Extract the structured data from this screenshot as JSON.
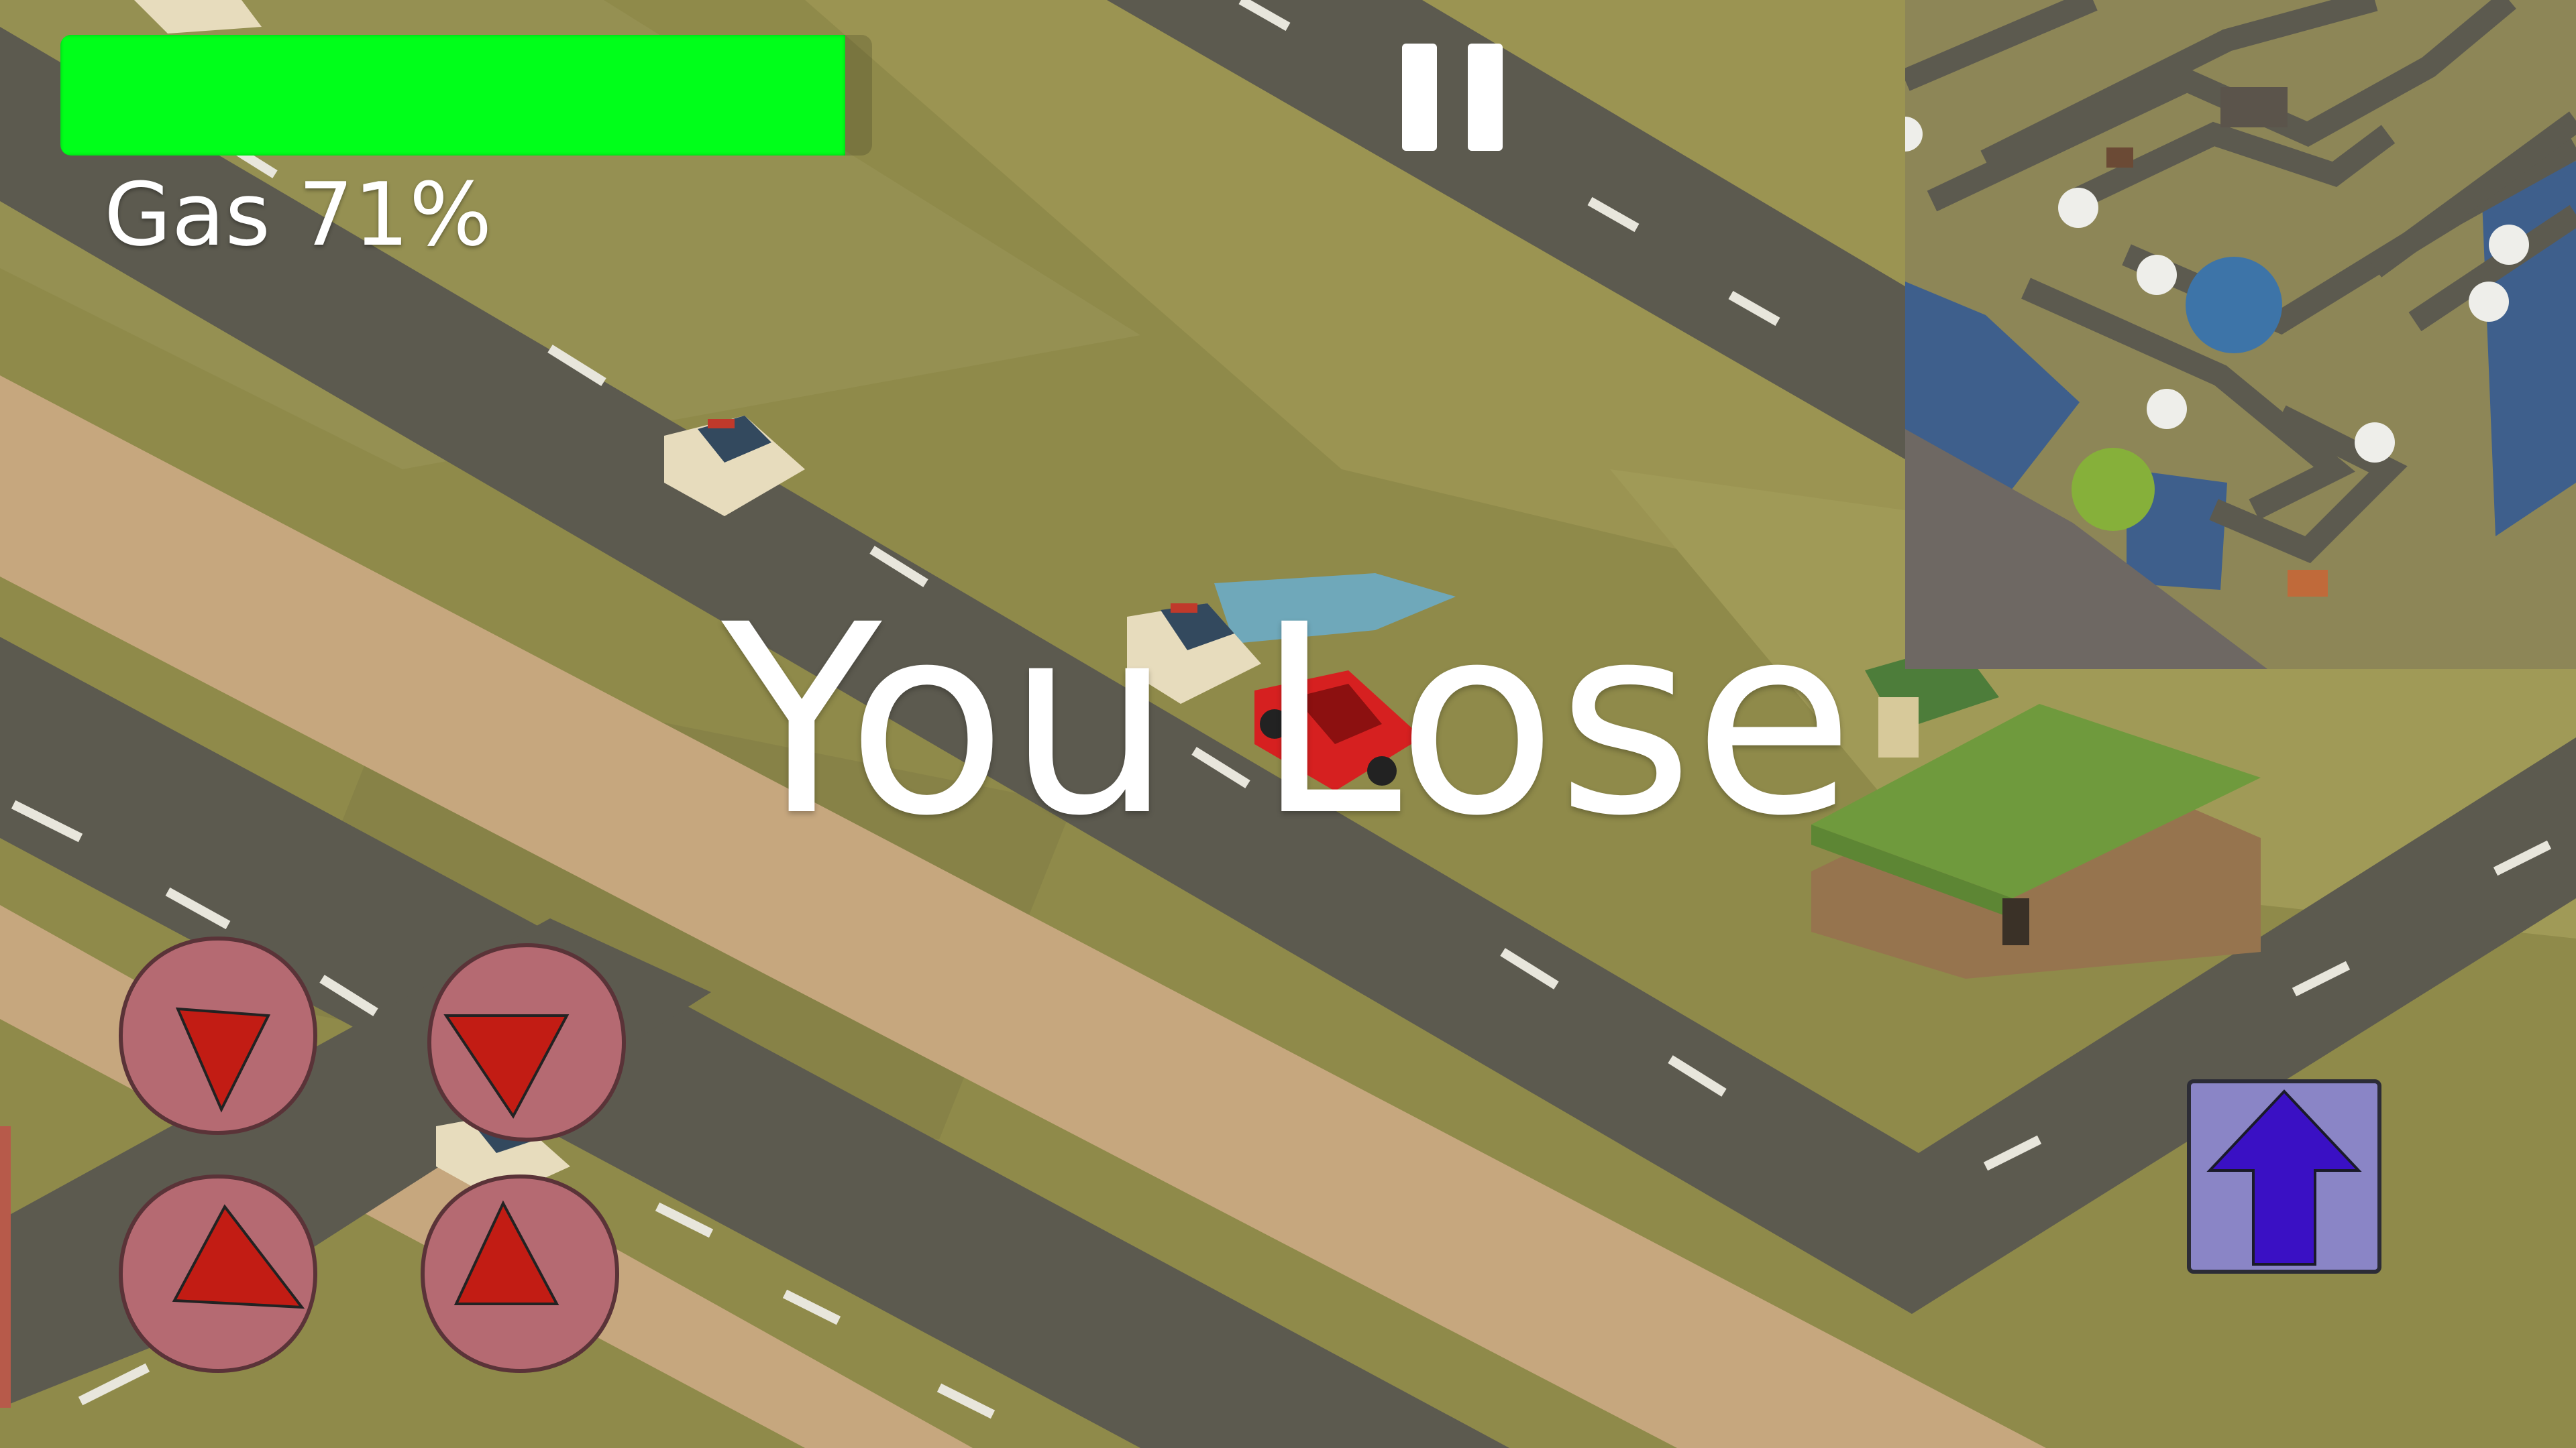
{
  "hud": {
    "gas_label": "Gas 71%",
    "gas_fraction": 0.71,
    "gas_color": "#00ff1a"
  },
  "pause": {
    "icon": "pause-icon"
  },
  "overlay": {
    "lose_text": "You Lose"
  },
  "minimap": {
    "icon": "minimap"
  },
  "controls": {
    "steer_left_down": "arrow-down-icon",
    "steer_right_down": "arrow-down-icon",
    "steer_left_up": "arrow-up-icon",
    "steer_right_up": "arrow-up-icon",
    "accelerate": "arrow-up-icon"
  },
  "colors": {
    "grass": "#8f8a4a",
    "road": "#5c5a4f",
    "sand": "#c6a77e",
    "control_button": "#b56a72",
    "control_arrow": "#c21c14",
    "accelerate_arrow": "#3a10c4"
  }
}
